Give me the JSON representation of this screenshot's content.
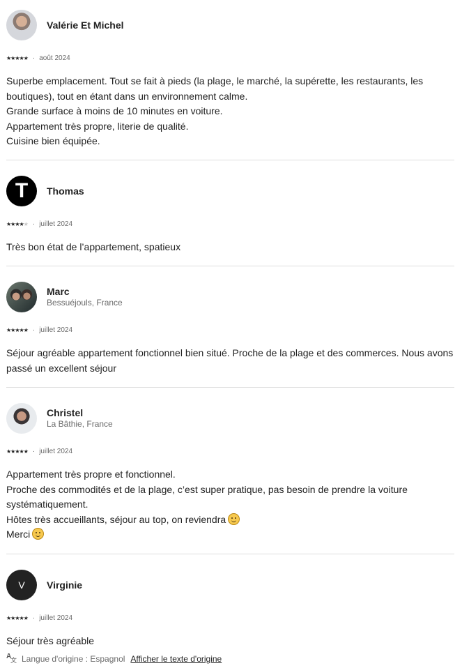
{
  "reviews": [
    {
      "name": "Valérie Et Michel",
      "rating": 5,
      "date": "août 2024",
      "text_lines": [
        "Superbe emplacement. Tout se fait à pieds (la plage, le marché, la supérette, les restaurants, les boutiques), tout en étant dans un environnement calme.",
        "Grande surface à moins de 10 minutes en voiture.",
        "Appartement très propre, literie de qualité.",
        "Cuisine bien équipée."
      ]
    },
    {
      "name": "Thomas",
      "avatar_letter": "T",
      "rating": 4,
      "date": "juillet 2024",
      "text_lines": [
        "Très bon état de l’appartement, spatieux"
      ]
    },
    {
      "name": "Marc",
      "location": "Bessuéjouls, France",
      "rating": 5,
      "date": "juillet 2024",
      "text_lines": [
        "Séjour agréable appartement fonctionnel bien situé. Proche de la plage et des commerces. Nous avons passé un excellent séjour"
      ]
    },
    {
      "name": "Christel",
      "location": "La Bâthie, France",
      "rating": 5,
      "date": "juillet 2024",
      "text_lines": [
        "Appartement très propre et fonctionnel.",
        "Proche des commodités et de la plage, c’est super pratique, pas besoin de prendre la voiture systématiquement.",
        "Hôtes très accueillants, séjour au top, on reviendra",
        "Merci"
      ],
      "emoji_icon": "smiling-face-icon"
    },
    {
      "name": "Virginie",
      "avatar_letter": "V",
      "rating": 5,
      "date": "juillet 2024",
      "text_lines": [
        "Séjour très agréable"
      ],
      "translation": {
        "label": "Langue d'origine : Espagnol",
        "link": "Afficher le texte d'origine",
        "icon": "translate-icon"
      }
    }
  ],
  "ui": {
    "separator": "·",
    "star_full": "★",
    "star_empty": "★"
  },
  "colors": {
    "text": "#222222",
    "secondary_text": "#6a6a6a",
    "divider": "#dddddd",
    "letter_avatar": "#000000"
  }
}
